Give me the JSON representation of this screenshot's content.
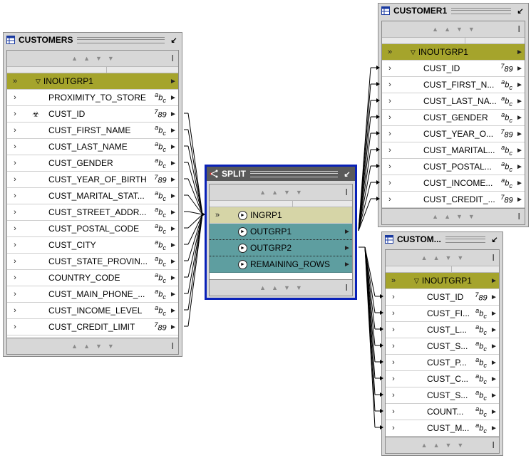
{
  "customers": {
    "title": "CUSTOMERS",
    "group": "INOUTGRP1",
    "attributes": [
      {
        "name": "PROXIMITY_TO_STORE",
        "type": "abc",
        "key": false
      },
      {
        "name": "CUST_ID",
        "type": "789",
        "key": true
      },
      {
        "name": "CUST_FIRST_NAME",
        "type": "abc",
        "key": false
      },
      {
        "name": "CUST_LAST_NAME",
        "type": "abc",
        "key": false
      },
      {
        "name": "CUST_GENDER",
        "type": "abc",
        "key": false
      },
      {
        "name": "CUST_YEAR_OF_BIRTH",
        "type": "789",
        "key": false
      },
      {
        "name": "CUST_MARITAL_STAT...",
        "type": "abc",
        "key": false
      },
      {
        "name": "CUST_STREET_ADDR...",
        "type": "abc",
        "key": false
      },
      {
        "name": "CUST_POSTAL_CODE",
        "type": "abc",
        "key": false
      },
      {
        "name": "CUST_CITY",
        "type": "abc",
        "key": false
      },
      {
        "name": "CUST_STATE_PROVIN...",
        "type": "abc",
        "key": false
      },
      {
        "name": "COUNTRY_CODE",
        "type": "abc",
        "key": false
      },
      {
        "name": "CUST_MAIN_PHONE_...",
        "type": "abc",
        "key": false
      },
      {
        "name": "CUST_INCOME_LEVEL",
        "type": "abc",
        "key": false
      },
      {
        "name": "CUST_CREDIT_LIMIT",
        "type": "789",
        "key": false
      }
    ]
  },
  "split": {
    "title": "SPLIT",
    "input_group": "INGRP1",
    "output_groups": [
      "OUTGRP1",
      "OUTGRP2",
      "REMAINING_ROWS"
    ]
  },
  "customer1": {
    "title": "CUSTOMER1",
    "group": "INOUTGRP1",
    "attributes": [
      {
        "name": "CUST_ID",
        "type": "789"
      },
      {
        "name": "CUST_FIRST_N...",
        "type": "abc"
      },
      {
        "name": "CUST_LAST_NA...",
        "type": "abc"
      },
      {
        "name": "CUST_GENDER",
        "type": "abc"
      },
      {
        "name": "CUST_YEAR_O...",
        "type": "789"
      },
      {
        "name": "CUST_MARITAL...",
        "type": "abc"
      },
      {
        "name": "CUST_POSTAL...",
        "type": "abc"
      },
      {
        "name": "CUST_INCOME...",
        "type": "abc"
      },
      {
        "name": "CUST_CREDIT_...",
        "type": "789"
      }
    ]
  },
  "customer2": {
    "title": "CUSTOM...",
    "group": "INOUTGRP1",
    "attributes": [
      {
        "name": "CUST_ID",
        "type": "789"
      },
      {
        "name": "CUST_FI...",
        "type": "abc"
      },
      {
        "name": "CUST_L...",
        "type": "abc"
      },
      {
        "name": "CUST_S...",
        "type": "abc"
      },
      {
        "name": "CUST_P...",
        "type": "abc"
      },
      {
        "name": "CUST_C...",
        "type": "abc"
      },
      {
        "name": "CUST_S...",
        "type": "abc"
      },
      {
        "name": "COUNT...",
        "type": "abc"
      },
      {
        "name": "CUST_M...",
        "type": "abc"
      }
    ]
  },
  "icons": {
    "table": "table-icon",
    "minimize": "minimize-icon",
    "chevron": "chevron-right-icon",
    "key": "key-icon",
    "port": "port-icon"
  },
  "colors": {
    "group_row": "#a5a42c",
    "input_group_row": "#d6d5a7",
    "output_group_row": "#5e9ea0",
    "split_border": "#0a22b8",
    "panel": "#d7d7d7"
  }
}
